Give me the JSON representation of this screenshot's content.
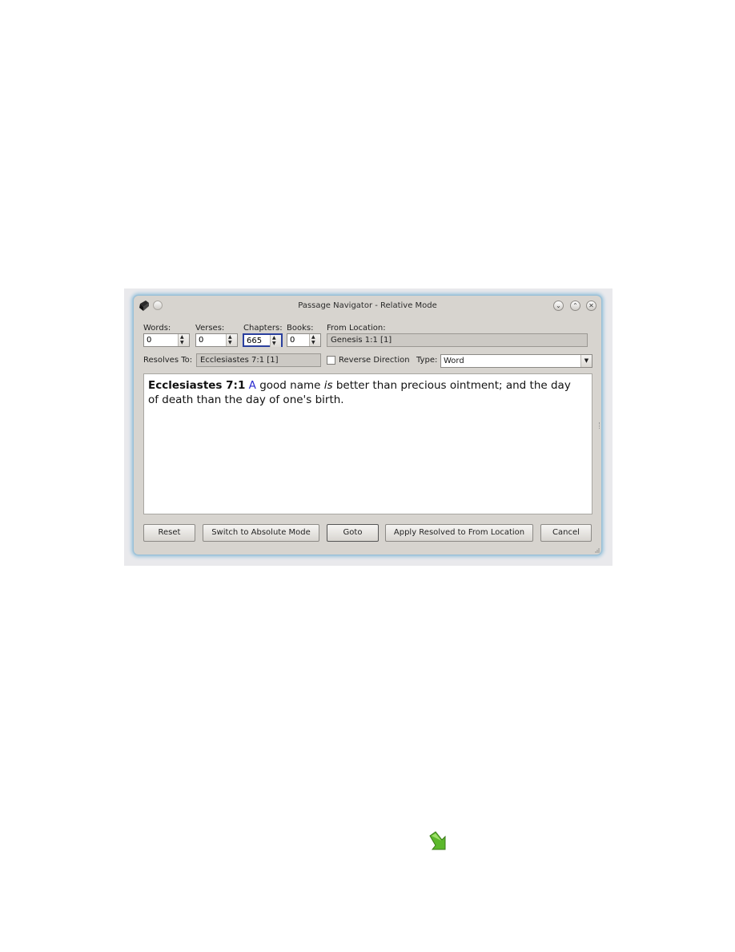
{
  "window": {
    "title": "Passage Navigator - Relative Mode"
  },
  "fields": {
    "words": {
      "label": "Words:",
      "value": "0"
    },
    "verses": {
      "label": "Verses:",
      "value": "0"
    },
    "chapters": {
      "label": "Chapters:",
      "value": "665"
    },
    "books": {
      "label": "Books:",
      "value": "0"
    },
    "from_location": {
      "label": "From Location:",
      "value": "Genesis 1:1 [1]"
    }
  },
  "resolves": {
    "label": "Resolves To:",
    "value": "Ecclesiastes 7:1 [1]"
  },
  "reverse_direction": {
    "label": "Reverse Direction",
    "checked": false
  },
  "type": {
    "label": "Type:",
    "selected": "Word"
  },
  "passage": {
    "reference": "Ecclesiastes 7:1",
    "first_word": "A",
    "text_a": "good name",
    "italic_word": "is",
    "text_b": "better than precious ointment; and the day of death than the day of one's birth."
  },
  "buttons": {
    "reset": "Reset",
    "switch_mode": "Switch to Absolute Mode",
    "goto": "Goto",
    "apply": "Apply Resolved to From Location",
    "cancel": "Cancel"
  },
  "icons": {
    "app": "book-icon",
    "menu": "window-menu-icon",
    "minimize": "minimize-icon",
    "maximize": "maximize-icon",
    "close": "close-icon",
    "arrow": "green-down-arrow-icon"
  },
  "colors": {
    "focus_border": "#2a3f9e",
    "link_word": "#2b2bcf",
    "window_glow": "#9cc4dc"
  }
}
